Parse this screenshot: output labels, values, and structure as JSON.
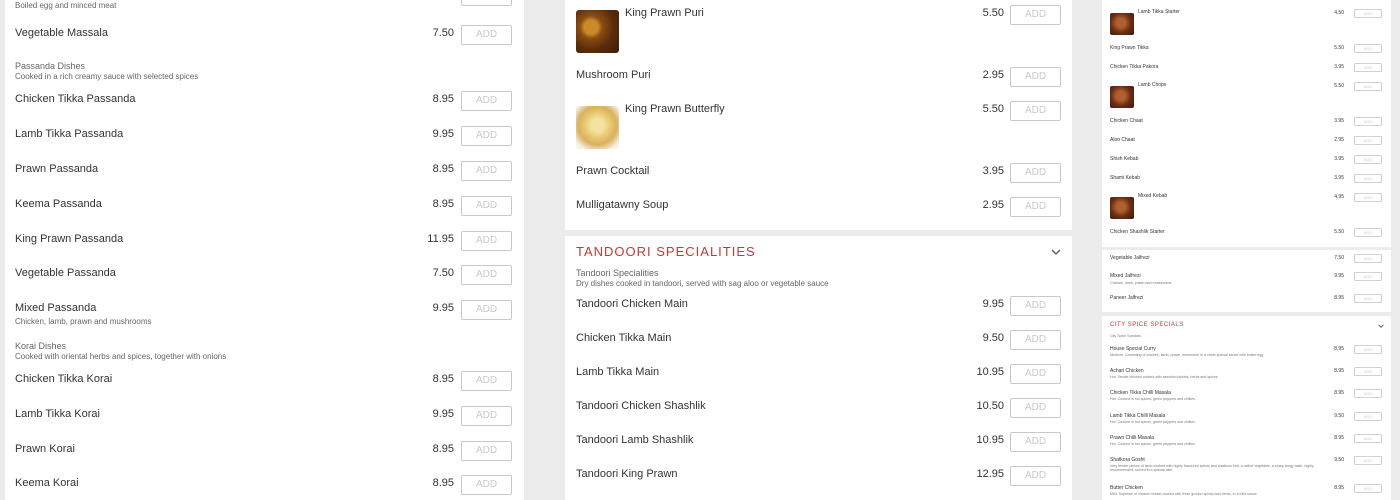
{
  "left": {
    "top_desc": "Boiled egg and minced meat",
    "vegetable_massala": {
      "name": "Vegetable Massala",
      "price": "7.50"
    },
    "passanda_heading": "Passanda Dishes",
    "passanda_desc": "Cooked in a rich creamy sauce with selected spices",
    "passanda_items": [
      {
        "name": "Chicken Tikka Passanda",
        "price": "8.95"
      },
      {
        "name": "Lamb Tikka Passanda",
        "price": "9.95"
      },
      {
        "name": "Prawn Passanda",
        "price": "8.95"
      },
      {
        "name": "Keema Passanda",
        "price": "8.95"
      },
      {
        "name": "King Prawn Passanda",
        "price": "11.95"
      },
      {
        "name": "Vegetable Passanda",
        "price": "7.50"
      },
      {
        "name": "Mixed Passanda",
        "price": "9.95",
        "desc": "Chicken, lamb, prawn and mushrooms"
      }
    ],
    "korai_heading": "Korai Dishes",
    "korai_desc": "Cooked with oriental herbs and spices, together with onions",
    "korai_items": [
      {
        "name": "Chicken Tikka Korai",
        "price": "8.95"
      },
      {
        "name": "Lamb Tikka Korai",
        "price": "9.95"
      },
      {
        "name": "Prawn Korai",
        "price": "8.95"
      },
      {
        "name": "Keema Korai",
        "price": "8.95"
      }
    ]
  },
  "add_label": "ADD",
  "mid": {
    "starters": [
      {
        "name": "King Prawn Puri",
        "price": "5.50",
        "image": "curry-dish-photo"
      },
      {
        "name": "Mushroom Puri",
        "price": "2.95"
      },
      {
        "name": "King Prawn Butterfly",
        "price": "5.50",
        "image": "fried-prawn-photo"
      },
      {
        "name": "Prawn Cocktail",
        "price": "3.95"
      },
      {
        "name": "Mulligatawny Soup",
        "price": "2.95"
      }
    ],
    "tandoori_title": "TANDOORI SPECIALITIES",
    "tandoori_heading": "Tandoori Specialities",
    "tandoori_desc": "Dry dishes cooked in tandoori, served with sag aloo or vegetable sauce",
    "tandoori_items": [
      {
        "name": "Tandoori Chicken Main",
        "price": "9.95"
      },
      {
        "name": "Chicken Tikka Main",
        "price": "9.50"
      },
      {
        "name": "Lamb Tikka Main",
        "price": "10.95"
      },
      {
        "name": "Tandoori Chicken Shashlik",
        "price": "10.50"
      },
      {
        "name": "Tandoori Lamb Shashlik",
        "price": "10.95"
      },
      {
        "name": "Tandoori King Prawn",
        "price": "12.95"
      }
    ]
  },
  "right": {
    "starters": [
      {
        "name": "Lamb Tikka Starter",
        "price": "4.50",
        "image": true
      },
      {
        "name": "King Prawn Tikka",
        "price": "5.50"
      },
      {
        "name": "Chicken Tikka Pakora",
        "price": "3.95"
      },
      {
        "name": "Lamb Chops",
        "price": "5.50",
        "image": true
      },
      {
        "name": "Chicken Chaat",
        "price": "3.95"
      },
      {
        "name": "Aloo Chaat",
        "price": "2.95"
      },
      {
        "name": "Shish Kebab",
        "price": "3.95"
      },
      {
        "name": "Shami Kebab",
        "price": "3.95"
      },
      {
        "name": "Mixed Kebab",
        "price": "4.95",
        "image": true
      },
      {
        "name": "Chicken Shashlik Starter",
        "price": "5.50"
      }
    ],
    "jalfrezi": [
      {
        "name": "Vegetable Jalfrezi",
        "price": "7.50"
      },
      {
        "name": "Mixed Jalfrezi",
        "price": "9.95",
        "desc": "Chicken, lamb, prawn and mushrooms"
      },
      {
        "name": "Paneer Jalfrezi",
        "price": "8.95"
      }
    ],
    "city_title": "CITY SPICE SPECIALS",
    "city_heading": "City Spice Specials",
    "city_items": [
      {
        "name": "House Special Curry",
        "price": "8.95",
        "desc": "Medium. Consisting of chicken, lamb, prawn, mushroom in a chefs special sauce with boiled egg"
      },
      {
        "name": "Achari Chicken",
        "price": "8.95",
        "desc": "Hot. Tender chicken cooked with assorted pickles, herbs and spices"
      },
      {
        "name": "Chicken Tikka Chilli Masala",
        "price": "8.95",
        "desc": "Hot. Cooked in hot spices, green peppers and chillies"
      },
      {
        "name": "Lamb Tikka Chilli Masala",
        "price": "9.50",
        "desc": "Hot. Cooked in hot spices, green peppers and chillies"
      },
      {
        "name": "Prawn Chilli Masala",
        "price": "8.95",
        "desc": "Hot. Cooked in hot spices, green peppers and chillies"
      },
      {
        "name": "Shatkora Gosht",
        "price": "9.50",
        "desc": "Very tender pieces of lamb cooked with highly flavoured spices and shatkora fruit, a native vegetable, a sharp tangy taste. highly recommended, served in a special dish"
      },
      {
        "name": "Butter Chicken",
        "price": "8.95",
        "desc": "Mild. Supreme of chicken breast cooked with fresh ground spices and herbs, in a mild sauce"
      }
    ]
  }
}
